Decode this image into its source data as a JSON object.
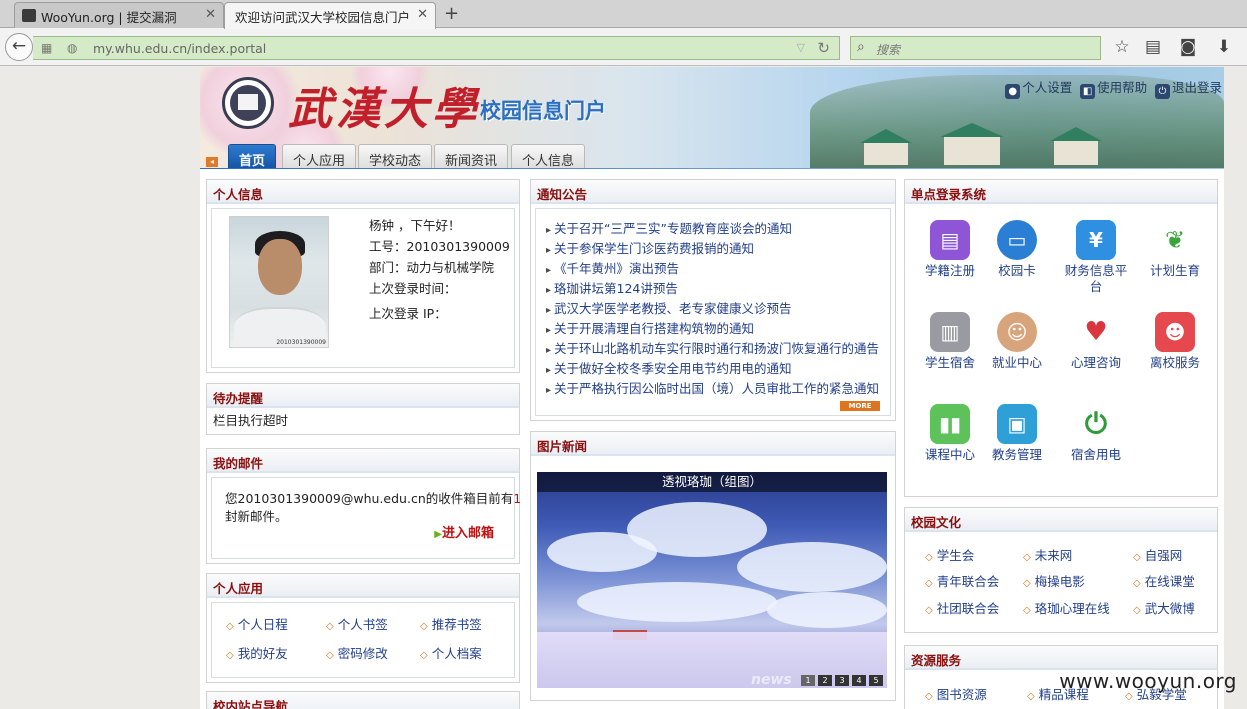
{
  "browser": {
    "tabs": [
      {
        "title": "WooYun.org | 提交漏洞"
      },
      {
        "title": "欢迎访问武汉大学校园信息门户"
      }
    ],
    "url": "my.whu.edu.cn/index.portal",
    "search_placeholder": "搜索"
  },
  "header": {
    "logo_text": "武漢大學",
    "portal_title": "校园信息门户",
    "links": [
      {
        "label": "个人设置",
        "icon": "user-icon"
      },
      {
        "label": "使用帮助",
        "icon": "help-book-icon"
      },
      {
        "label": "退出登录",
        "icon": "power-icon"
      }
    ]
  },
  "nav": {
    "tabs": [
      {
        "label": "首页",
        "active": true
      },
      {
        "label": "个人应用"
      },
      {
        "label": "学校动态"
      },
      {
        "label": "新闻资讯"
      },
      {
        "label": "个人信息"
      }
    ]
  },
  "personal": {
    "title": "个人信息",
    "greeting": "杨钟 ，下午好！",
    "work_id": "工号：2010301390009",
    "department": "部门：动力与机械学院",
    "last_login_time": "上次登录时间：",
    "last_login_ip": "上次登录 IP：",
    "photo_id": "2010301390009"
  },
  "todo": {
    "title": "待办提醒",
    "text": "栏目执行超时"
  },
  "mail": {
    "title": "我的邮件",
    "line1_prefix": "您2010301390009@whu.edu.cn的收件箱目前有",
    "count": "1",
    "line2": "封新邮件。",
    "enter_label": "进入邮箱"
  },
  "apps": {
    "title": "个人应用",
    "items": [
      "个人日程",
      "个人书签",
      "推荐书签",
      "我的好友",
      "密码修改",
      "个人档案"
    ]
  },
  "campus_nav": {
    "title": "校内站点导航"
  },
  "notices": {
    "title": "通知公告",
    "items": [
      "关于召开“三严三实”专题教育座谈会的通知",
      "关于参保学生门诊医药费报销的通知",
      "《千年黄州》演出预告",
      "珞珈讲坛第124讲预告",
      "武汉大学医学老教授、老专家健康义诊预告",
      "关于开展清理自行搭建构筑物的通知",
      "关于环山北路机动车实行限时通行和扬波门恢复通行的通告",
      "关于做好全校冬季安全用电节约用电的通知",
      "关于严格执行因公临时出国（境）人员审批工作的紧急通知"
    ],
    "more_label": "MORE"
  },
  "photo_news": {
    "title": "图片新闻",
    "caption": "透视珞珈（组图）",
    "pager": [
      "1",
      "2",
      "3",
      "4",
      "5"
    ],
    "overlay_text": "news"
  },
  "sso": {
    "title": "单点登录系统",
    "items": [
      {
        "label": "学籍注册",
        "icon": "student-card-icon",
        "color": "#8e55d6"
      },
      {
        "label": "校园卡",
        "icon": "campus-card-icon",
        "color": "#2a7fd4"
      },
      {
        "label": "财务信息平台",
        "icon": "yen-icon",
        "color": "#2f8fe0"
      },
      {
        "label": "计划生育",
        "icon": "family-planning-icon",
        "color": "#ffffff"
      },
      {
        "label": "学生宿舍",
        "icon": "dormitory-icon",
        "color": "#9a9aa3"
      },
      {
        "label": "就业中心",
        "icon": "headset-operator-icon",
        "color": "#d8a47c"
      },
      {
        "label": "心理咨询",
        "icon": "heart-people-icon",
        "color": "#ffffff"
      },
      {
        "label": "离校服务",
        "icon": "people-icon",
        "color": "#e5484d"
      },
      {
        "label": "课程中心",
        "icon": "books-icon",
        "color": "#5cc259"
      },
      {
        "label": "教务管理",
        "icon": "cubes-icon",
        "color": "#2f9fd8"
      },
      {
        "label": "宿舍用电",
        "icon": "power-button-icon",
        "color": "#ffffff"
      }
    ]
  },
  "culture": {
    "title": "校园文化",
    "items": [
      "学生会",
      "未来网",
      "自强网",
      "青年联合会",
      "梅操电影",
      "在线课堂",
      "社团联合会",
      "珞珈心理在线",
      "武大微博"
    ]
  },
  "resources": {
    "title": "资源服务",
    "items": [
      "图书资源",
      "精品课程",
      "弘毅学堂"
    ]
  },
  "watermark": "www.wooyun.org"
}
